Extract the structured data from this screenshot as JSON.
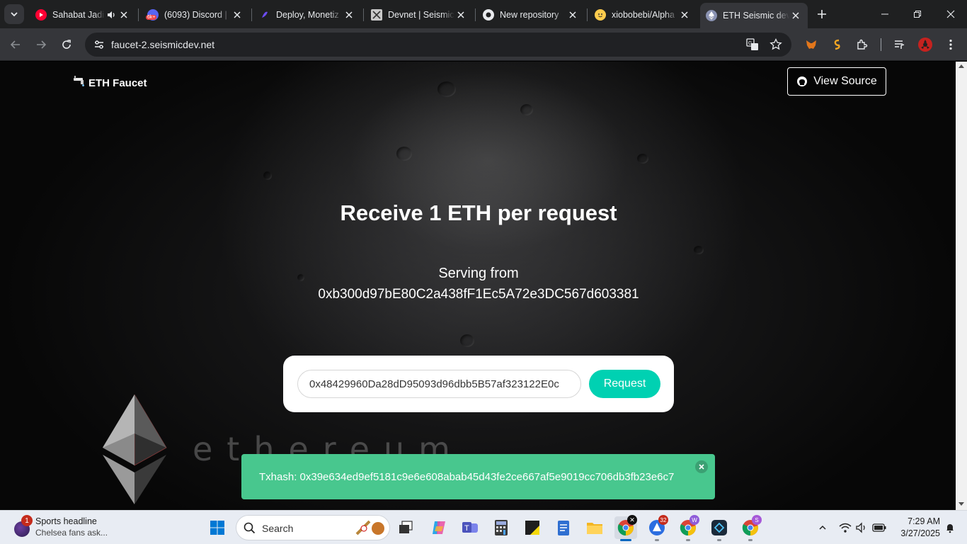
{
  "browser": {
    "tabs": [
      {
        "title": "Sahabat Jadi",
        "favicon_color": "#ff0033",
        "favicon": "youtube-icon"
      },
      {
        "title": "(6093) Discord |",
        "favicon_color": "#5865f2",
        "favicon": "discord-icon",
        "badge": "6k+"
      },
      {
        "title": "Deploy, Monetiz",
        "favicon_color": "#6c4cf1",
        "favicon": "deploy-icon"
      },
      {
        "title": "Devnet | Seismic",
        "favicon_color": "#c9c9c9",
        "favicon": "seismic-icon"
      },
      {
        "title": "New repository",
        "favicon_color": "#e8eaed",
        "favicon": "github-icon"
      },
      {
        "title": "xiobobebi/Alpha",
        "favicon_color": "#ffcc4d",
        "favicon": "huggingface-icon"
      },
      {
        "title": "ETH Seismic dev",
        "favicon_color": "#8a92b2",
        "favicon": "ethereum-icon",
        "active": true
      }
    ],
    "url": "faucet-2.seismicdev.net"
  },
  "page": {
    "brand": "ETH Faucet",
    "view_source": "View Source",
    "headline": "Receive 1 ETH per request",
    "serving_label": "Serving from",
    "serving_address": "0xb300d97bE80C2a438fF1Ec5A72e3DC567d603381",
    "input_value": "0x48429960Da28dD95093d96dbb5B57af323122E0c",
    "request_button": "Request",
    "background_word": "ethereum",
    "toast": "Txhash: 0x39e634ed9ef5181c9e6e608abab45d43fe2ce667af5e9019cc706db3fb23e6c7",
    "accent": "#00d1b2",
    "toast_color": "#48c78e"
  },
  "taskbar": {
    "news_badge": "1",
    "news_title": "Sports headline",
    "news_sub": "Chelsea fans ask...",
    "search_label": "Search",
    "badge_32": "32",
    "badge_w": "W",
    "badge_s": "S",
    "time": "7:29 AM",
    "date": "3/27/2025"
  }
}
